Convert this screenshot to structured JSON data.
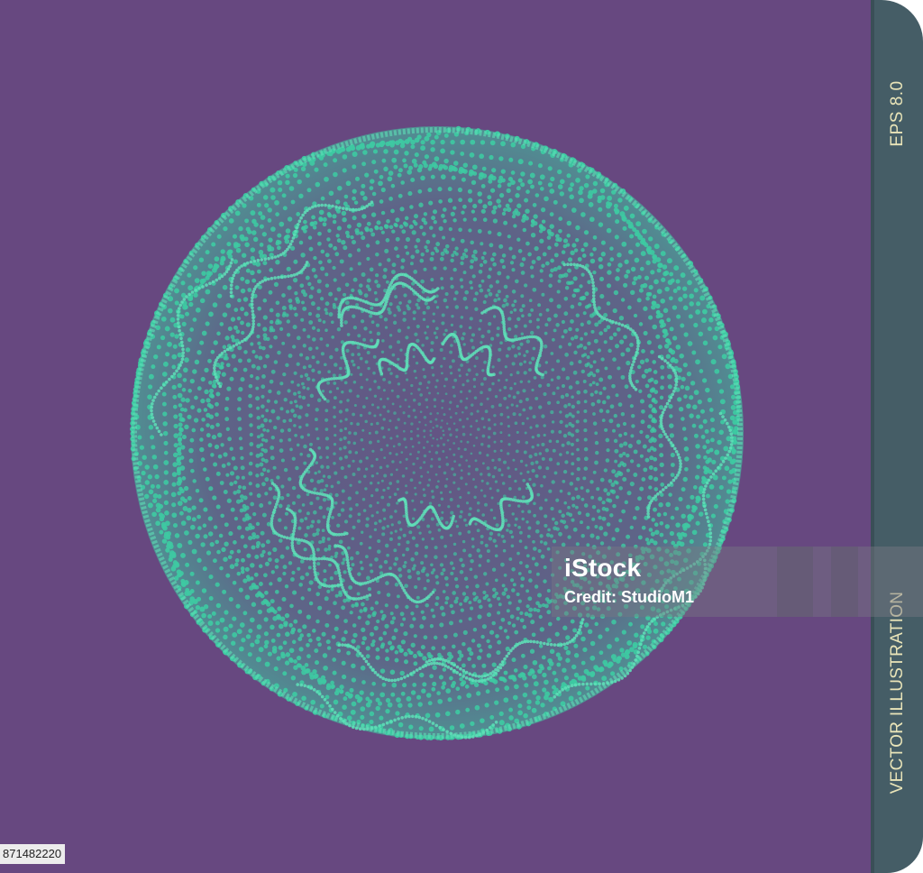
{
  "colors": {
    "background": "#674880",
    "sphere": "#3ec9a2",
    "sphere_highlight": "#5fe0b8",
    "side_tab": "#455d66",
    "side_text": "#e9e4b8"
  },
  "side_tab": {
    "format_label": "EPS 8.0",
    "type_label": "VECTOR ILLUSTRATION"
  },
  "watermark": {
    "logo": "iStock",
    "credit": "Credit: StudioM1"
  },
  "stock_id": "871482220",
  "illustration": {
    "subject": "sphere-of-dots-icon"
  }
}
